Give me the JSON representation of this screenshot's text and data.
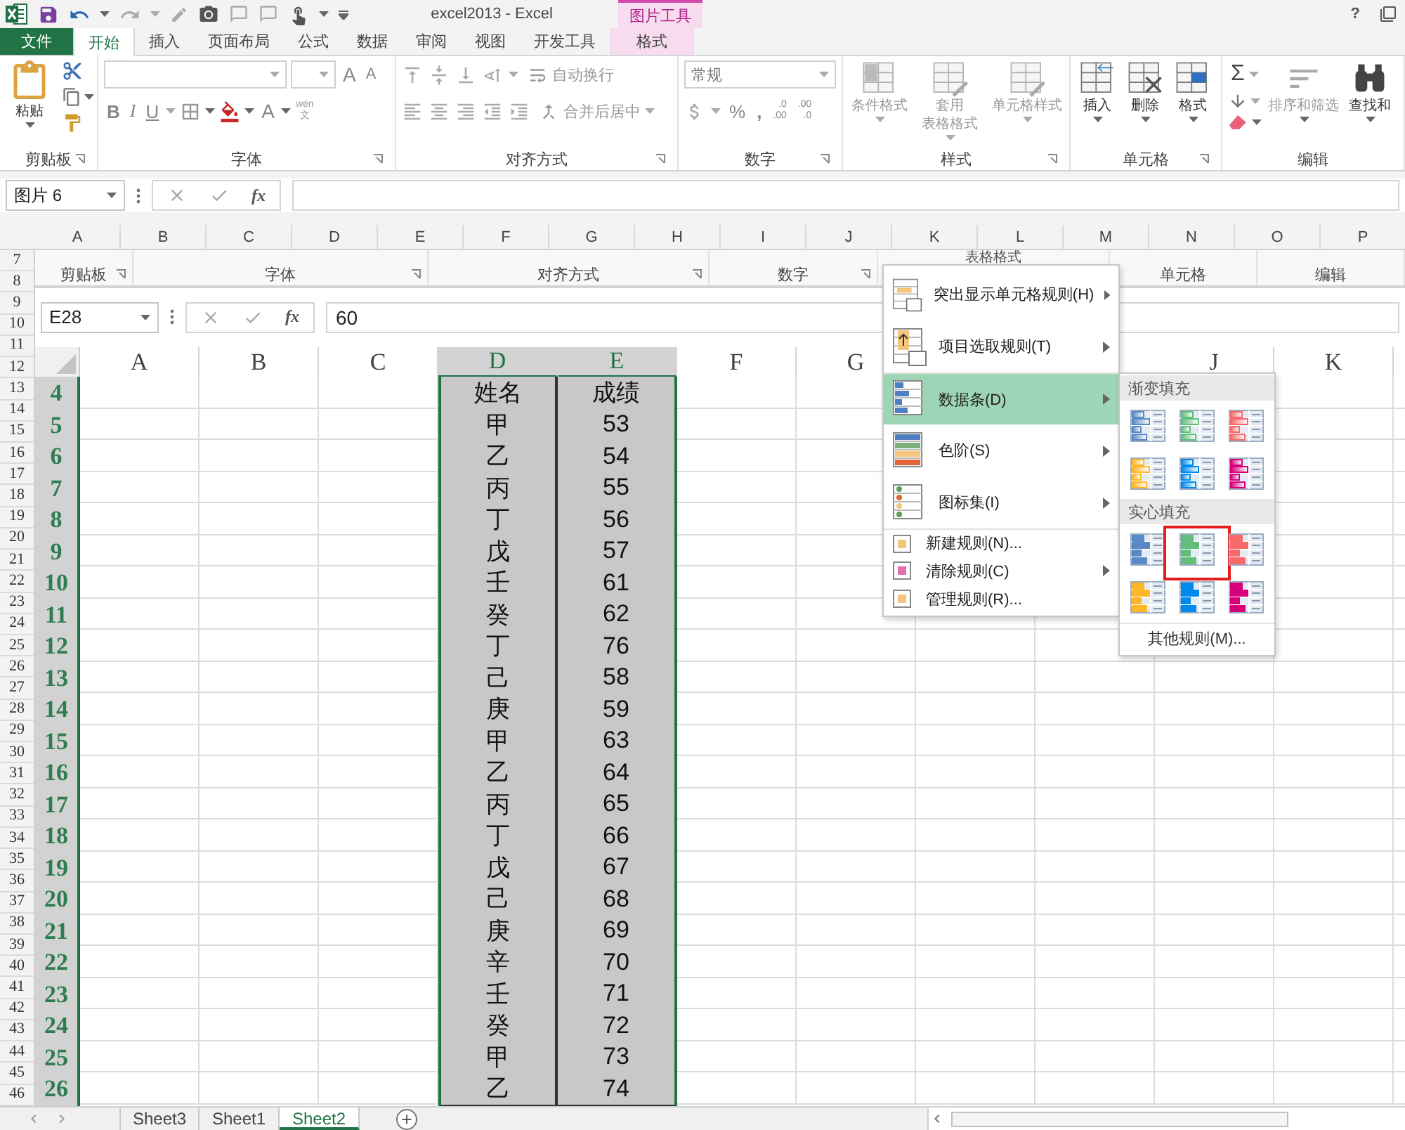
{
  "window": {
    "title": "excel2013 - Excel",
    "context_group": "图片工具",
    "help": "?"
  },
  "ribbon_tabs": [
    {
      "label": "文件",
      "kind": "file",
      "selected": false
    },
    {
      "label": "开始",
      "kind": "normal",
      "selected": true
    },
    {
      "label": "插入",
      "kind": "normal",
      "selected": false
    },
    {
      "label": "页面布局",
      "kind": "normal",
      "selected": false
    },
    {
      "label": "公式",
      "kind": "normal",
      "selected": false
    },
    {
      "label": "数据",
      "kind": "normal",
      "selected": false
    },
    {
      "label": "审阅",
      "kind": "normal",
      "selected": false
    },
    {
      "label": "视图",
      "kind": "normal",
      "selected": false
    },
    {
      "label": "开发工具",
      "kind": "normal",
      "selected": false
    },
    {
      "label": "格式",
      "kind": "context",
      "selected": false
    }
  ],
  "ribbon": {
    "clipboard": {
      "label": "剪贴板",
      "paste": "粘贴"
    },
    "font": {
      "label": "字体",
      "grow": "A",
      "shrink": "A",
      "bold": "B",
      "italic": "I",
      "underline": "U",
      "font_color": "A",
      "phonetic_top": "wén",
      "phonetic_bottom": "文"
    },
    "alignment": {
      "label": "对齐方式",
      "wrap_text": "自动换行",
      "merge": "合并后居中"
    },
    "number": {
      "label": "数字",
      "format": "常规",
      "percent": "%",
      "comma": ",",
      "increase_decimal": [
        ".0",
        ".00"
      ],
      "decrease_decimal": [
        ".00",
        ".0"
      ]
    },
    "styles": {
      "label": "样式",
      "buttons": [
        {
          "lines": [
            "条件格式"
          ],
          "disabled": true
        },
        {
          "lines": [
            "套用",
            "表格格式"
          ],
          "disabled": true
        },
        {
          "lines": [
            "单元格样式"
          ],
          "disabled": true
        }
      ]
    },
    "cells": {
      "label": "单元格",
      "buttons": [
        {
          "lines": [
            "插入"
          ],
          "disabled": false
        },
        {
          "lines": [
            "删除"
          ],
          "disabled": false
        },
        {
          "lines": [
            "格式"
          ],
          "disabled": false
        }
      ]
    },
    "editing": {
      "label": "编辑",
      "sum": "Σ",
      "buttons": [
        {
          "lines": [
            "排序和筛选"
          ],
          "disabled": true
        },
        {
          "lines": [
            "查找和"
          ],
          "disabled": false
        }
      ]
    }
  },
  "formula_bar": {
    "name_box": "图片 6",
    "fx": "fx"
  },
  "sheet": {
    "columns": [
      "A",
      "B",
      "C",
      "D",
      "E",
      "F",
      "G",
      "H",
      "I",
      "J",
      "K",
      "L",
      "M",
      "N",
      "O",
      "P"
    ],
    "row_numbers": [
      "7",
      "8",
      "9",
      "10",
      "11",
      "12",
      "13",
      "14",
      "15",
      "16",
      "17",
      "18",
      "19",
      "20",
      "21",
      "22",
      "23",
      "24",
      "25",
      "26",
      "27",
      "28",
      "29",
      "30",
      "31",
      "32",
      "33",
      "34",
      "35",
      "36",
      "37",
      "38",
      "39",
      "40",
      "41",
      "42",
      "43",
      "44",
      "45",
      "46"
    ]
  },
  "picture": {
    "ribbon_labels": [
      "剪贴板",
      "字体",
      "对齐方式",
      "数字",
      "单元格",
      "编辑"
    ],
    "styles_caption": "表格格式",
    "formula_bar": {
      "name_box": "E28",
      "fx": "fx",
      "value": "60"
    },
    "columns": [
      {
        "label": "A",
        "selected": false
      },
      {
        "label": "B",
        "selected": false
      },
      {
        "label": "C",
        "selected": false
      },
      {
        "label": "D",
        "selected": true
      },
      {
        "label": "E",
        "selected": true
      },
      {
        "label": "F",
        "selected": false
      },
      {
        "label": "G",
        "selected": false
      },
      {
        "label": "J",
        "selected": false
      },
      {
        "label": "K",
        "selected": false
      }
    ],
    "rows": [
      {
        "number": "4",
        "cells": [
          "姓名",
          "成绩"
        ]
      },
      {
        "number": "5",
        "cells": [
          "甲",
          "53"
        ]
      },
      {
        "number": "6",
        "cells": [
          "乙",
          "54"
        ]
      },
      {
        "number": "7",
        "cells": [
          "丙",
          "55"
        ]
      },
      {
        "number": "8",
        "cells": [
          "丁",
          "56"
        ]
      },
      {
        "number": "9",
        "cells": [
          "戊",
          "57"
        ]
      },
      {
        "number": "10",
        "cells": [
          "壬",
          "61"
        ]
      },
      {
        "number": "11",
        "cells": [
          "癸",
          "62"
        ]
      },
      {
        "number": "12",
        "cells": [
          "丁",
          "76"
        ]
      },
      {
        "number": "13",
        "cells": [
          "己",
          "58"
        ]
      },
      {
        "number": "14",
        "cells": [
          "庚",
          "59"
        ]
      },
      {
        "number": "15",
        "cells": [
          "甲",
          "63"
        ]
      },
      {
        "number": "16",
        "cells": [
          "乙",
          "64"
        ]
      },
      {
        "number": "17",
        "cells": [
          "丙",
          "65"
        ]
      },
      {
        "number": "18",
        "cells": [
          "丁",
          "66"
        ]
      },
      {
        "number": "19",
        "cells": [
          "戊",
          "67"
        ]
      },
      {
        "number": "20",
        "cells": [
          "己",
          "68"
        ]
      },
      {
        "number": "21",
        "cells": [
          "庚",
          "69"
        ]
      },
      {
        "number": "22",
        "cells": [
          "辛",
          "70"
        ]
      },
      {
        "number": "23",
        "cells": [
          "壬",
          "71"
        ]
      },
      {
        "number": "24",
        "cells": [
          "癸",
          "72"
        ]
      },
      {
        "number": "25",
        "cells": [
          "甲",
          "73"
        ]
      },
      {
        "number": "26",
        "cells": [
          "乙",
          "74"
        ]
      }
    ],
    "menu": {
      "items": [
        {
          "label": "突出显示单元格规则(H)",
          "kind": "large",
          "selected": false,
          "has_submenu": true
        },
        {
          "label": "项目选取规则(T)",
          "kind": "large",
          "selected": false,
          "has_submenu": true
        },
        {
          "label": "数据条(D)",
          "kind": "large",
          "selected": true,
          "has_submenu": true
        },
        {
          "label": "色阶(S)",
          "kind": "large",
          "selected": false,
          "has_submenu": true
        },
        {
          "label": "图标集(I)",
          "kind": "large",
          "selected": false,
          "has_submenu": true
        },
        {
          "label": "新建规则(N)...",
          "kind": "small",
          "selected": false,
          "has_submenu": false
        },
        {
          "label": "清除规则(C)",
          "kind": "small",
          "selected": false,
          "has_submenu": true
        },
        {
          "label": "管理规则(R)...",
          "kind": "small",
          "selected": false,
          "has_submenu": false
        }
      ]
    },
    "submenu": {
      "sections": [
        {
          "title": "渐变填充",
          "kind": "gradient",
          "swatches": [
            {
              "color": "#5a8ac6",
              "highlighted": false
            },
            {
              "color": "#63be7b",
              "highlighted": false
            },
            {
              "color": "#f8696b",
              "highlighted": false
            },
            {
              "color": "#ffb628",
              "highlighted": false
            },
            {
              "color": "#008aef",
              "highlighted": false
            },
            {
              "color": "#d6007b",
              "highlighted": false
            }
          ]
        },
        {
          "title": "实心填充",
          "kind": "solid",
          "swatches": [
            {
              "color": "#5a8ac6",
              "highlighted": false
            },
            {
              "color": "#63be7b",
              "highlighted": true
            },
            {
              "color": "#f8696b",
              "highlighted": false
            },
            {
              "color": "#ffb628",
              "highlighted": false
            },
            {
              "color": "#008aef",
              "highlighted": false
            },
            {
              "color": "#d6007b",
              "highlighted": false
            }
          ]
        }
      ],
      "more": "其他规则(M)..."
    }
  },
  "sheet_tabs": [
    {
      "label": "Sheet3",
      "selected": false
    },
    {
      "label": "Sheet1",
      "selected": false
    },
    {
      "label": "Sheet2",
      "selected": true
    }
  ]
}
